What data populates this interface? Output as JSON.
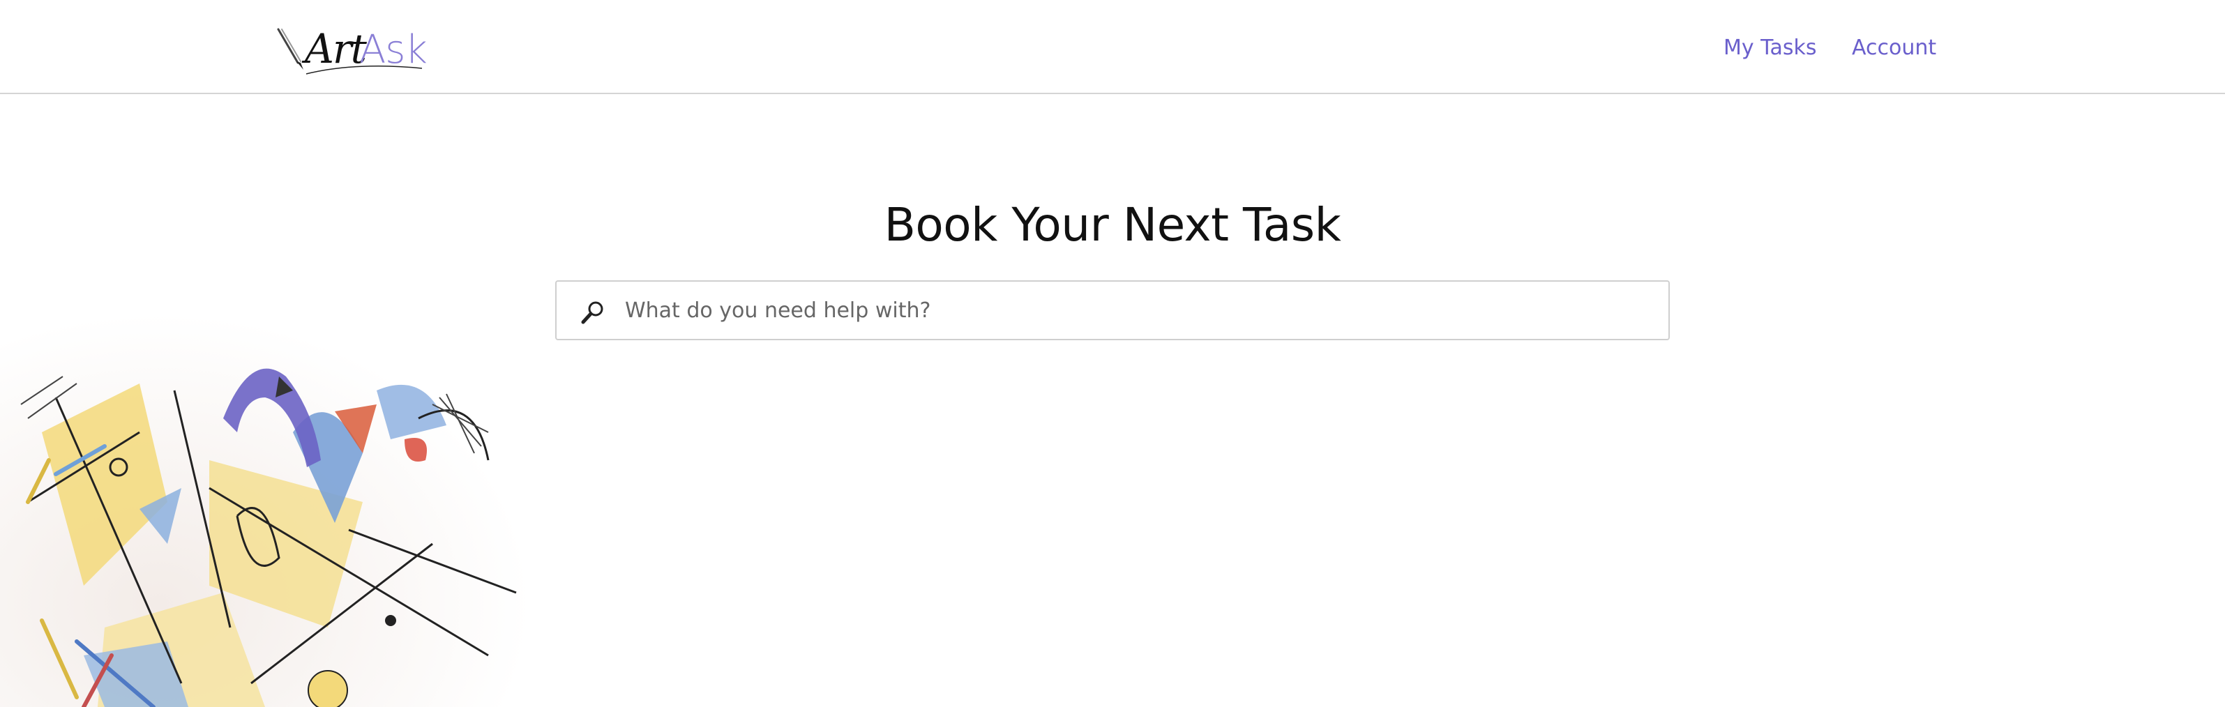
{
  "header": {
    "logo": {
      "art": "Art",
      "ask": "Ask"
    },
    "nav": [
      {
        "label": "My Tasks"
      },
      {
        "label": "Account"
      }
    ]
  },
  "main": {
    "title": "Book Your Next Task",
    "search": {
      "placeholder": "What do you need help with?",
      "value": "",
      "icon": "magnifier-icon"
    }
  },
  "colors": {
    "accent": "#6a5fcc",
    "logo_ask": "#8a7fd6",
    "divider": "#d4d4d4"
  }
}
